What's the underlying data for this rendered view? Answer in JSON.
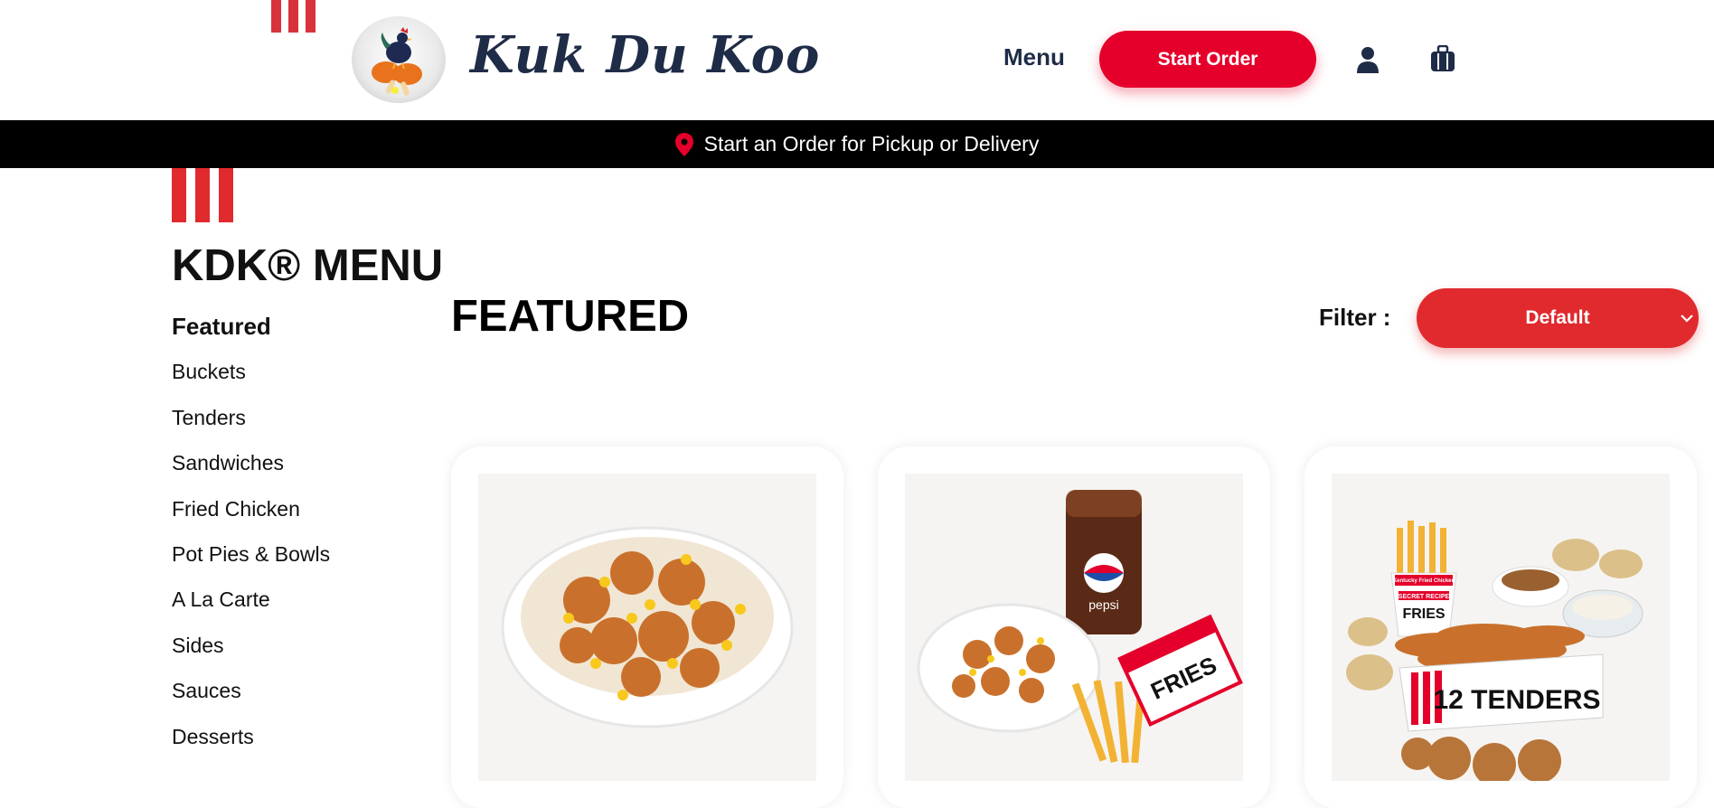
{
  "header": {
    "brand": "Kuk Du Koo",
    "menu_label": "Menu",
    "start_order_label": "Start Order",
    "icons": [
      "account-icon",
      "bag-icon"
    ]
  },
  "order_bar": {
    "text": "Start an Order for Pickup or Delivery",
    "icon": "location-pin-icon"
  },
  "sidebar": {
    "title": "KDK® MENU",
    "items": [
      {
        "label": "Featured",
        "active": true
      },
      {
        "label": "Buckets"
      },
      {
        "label": "Tenders"
      },
      {
        "label": "Sandwiches"
      },
      {
        "label": "Fried Chicken"
      },
      {
        "label": "Pot Pies & Bowls"
      },
      {
        "label": "A La Carte"
      },
      {
        "label": "Sides"
      },
      {
        "label": "Sauces"
      },
      {
        "label": "Desserts"
      }
    ]
  },
  "main": {
    "title": "FEATURED",
    "filter_label": "Filter :",
    "filter_value": "Default",
    "cards": [
      {
        "image": "famous-bowl"
      },
      {
        "image": "bowl-combo-with-pepsi-and-fries",
        "texts": [
          "pepsi",
          "FRIES"
        ]
      },
      {
        "image": "12-tenders-meal",
        "texts": [
          "12 TENDERS",
          "FRIES",
          "SECRET RECIPE",
          "Kentucky Fried Chicken"
        ]
      }
    ]
  },
  "colors": {
    "accent_red": "#e4002b",
    "brand_navy": "#1f2c47",
    "bar_black": "#000000"
  }
}
